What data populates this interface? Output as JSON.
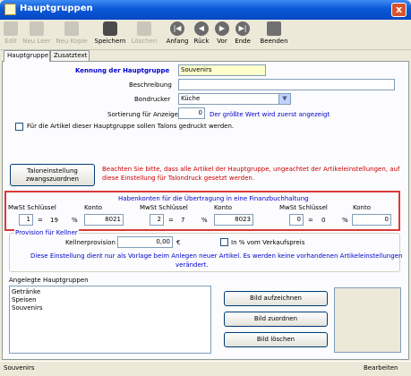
{
  "window": {
    "title": "Hauptgruppen",
    "close_symbol": "x"
  },
  "toolbar": {
    "edit": "Edit",
    "new_empty": "Neu Leer",
    "new_copy": "Neu Kopie",
    "save": "Speichern",
    "delete": "Löschen",
    "first": "Anfang",
    "back": "Rück",
    "forward": "Vor",
    "end": "Ende",
    "exit": "Beenden"
  },
  "tabs": [
    "Hauptgruppe",
    "Zusatztext"
  ],
  "form": {
    "kennung_label": "Kennung der Hauptgruppe",
    "kennung_value": "Souvenirs",
    "beschreibung_label": "Beschreibung",
    "beschreibung_value": "",
    "bondrucker_label": "Bondrucker",
    "bondrucker_value": "Küche",
    "sortierung_label": "Sortierung für Anzeige",
    "sortierung_value": "0",
    "sortierung_hint": "Der größte Wert wird zuerst angezeigt",
    "talons_label": "Für die Artikel dieser Hauptgruppe sollen Talons gedruckt werden.",
    "talon_button": "Taloneinstellung zwangszuordnen",
    "talon_note_1": "Beachten Sie bitte, dass alle Artikel der Hauptgruppe, ungeachtet der Artikeleinstellungen, auf",
    "talon_note_2": "diese Einstellung für Talondruck gesetzt werden."
  },
  "haben": {
    "title": "Habenkonten für die Übertragung in eine Finanzbuchhaltung",
    "groups": [
      {
        "mwst_label": "MwSt Schlüssel",
        "konto_label": "Konto",
        "key": "1",
        "rate": "19",
        "percent": "%",
        "konto": "8021"
      },
      {
        "mwst_label": "MwSt Schlüssel",
        "konto_label": "Konto",
        "key": "2",
        "rate": "7",
        "percent": "%",
        "konto": "8023"
      },
      {
        "mwst_label": "MwSt Schlüssel",
        "konto_label": "Konto",
        "key": "0",
        "rate": "0",
        "percent": "%",
        "konto": "0"
      }
    ],
    "eq": "="
  },
  "kellner": {
    "group_label": "Provision für Kellner",
    "provision_label": "Kellnerprovision",
    "provision_value": "0,00",
    "currency": "€",
    "vk_label": "In % vom Verkaufspreis",
    "note_1": "Diese Einstellung dient nur als Vorlage beim Anlegen neuer Artikel. Es werden keine vorhandenen Artikeleinstellungen",
    "note_2": "verändert."
  },
  "angelegte": {
    "label": "Angelegte Hauptgruppen",
    "items": [
      "Getränke",
      "Speisen",
      "Souvenirs"
    ]
  },
  "buttons": {
    "bild_aufzeichnen": "Bild aufzeichnen",
    "bild_zuordnen": "Bild zuordnen",
    "bild_loeschen": "Bild löschen"
  },
  "status": {
    "left": "Souvenirs",
    "right": "Bearbeiten"
  }
}
